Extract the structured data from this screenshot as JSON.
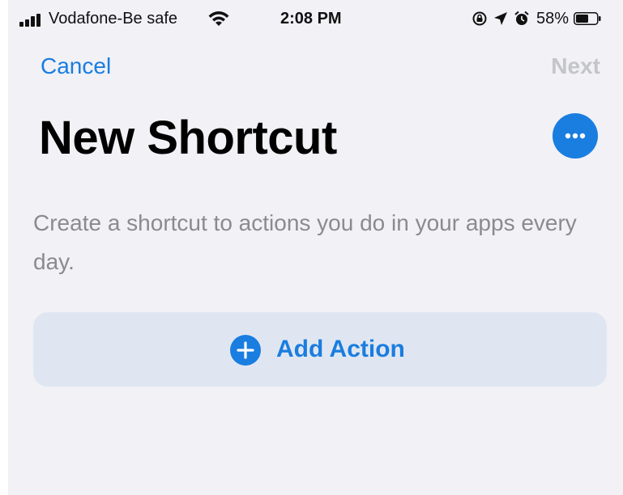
{
  "status_bar": {
    "carrier": "Vodafone-Be safe",
    "time": "2:08 PM",
    "battery_percent": "58%",
    "icons": [
      "signal-icon",
      "wifi-icon",
      "rotation-lock-icon",
      "location-arrow-icon",
      "alarm-icon",
      "battery-icon"
    ]
  },
  "nav": {
    "cancel_label": "Cancel",
    "next_label": "Next"
  },
  "header": {
    "title": "New Shortcut",
    "more_icon": "ellipsis-icon"
  },
  "main": {
    "description": "Create a shortcut to actions you do in your apps every day.",
    "add_action_label": "Add Action",
    "add_action_icon": "plus-circle-icon"
  },
  "colors": {
    "accent": "#1a7de0",
    "background": "#f1f1f6",
    "action_bg": "#e0e6f1",
    "secondary_text": "#8a8a8f",
    "disabled_text": "#c4c5c9"
  }
}
